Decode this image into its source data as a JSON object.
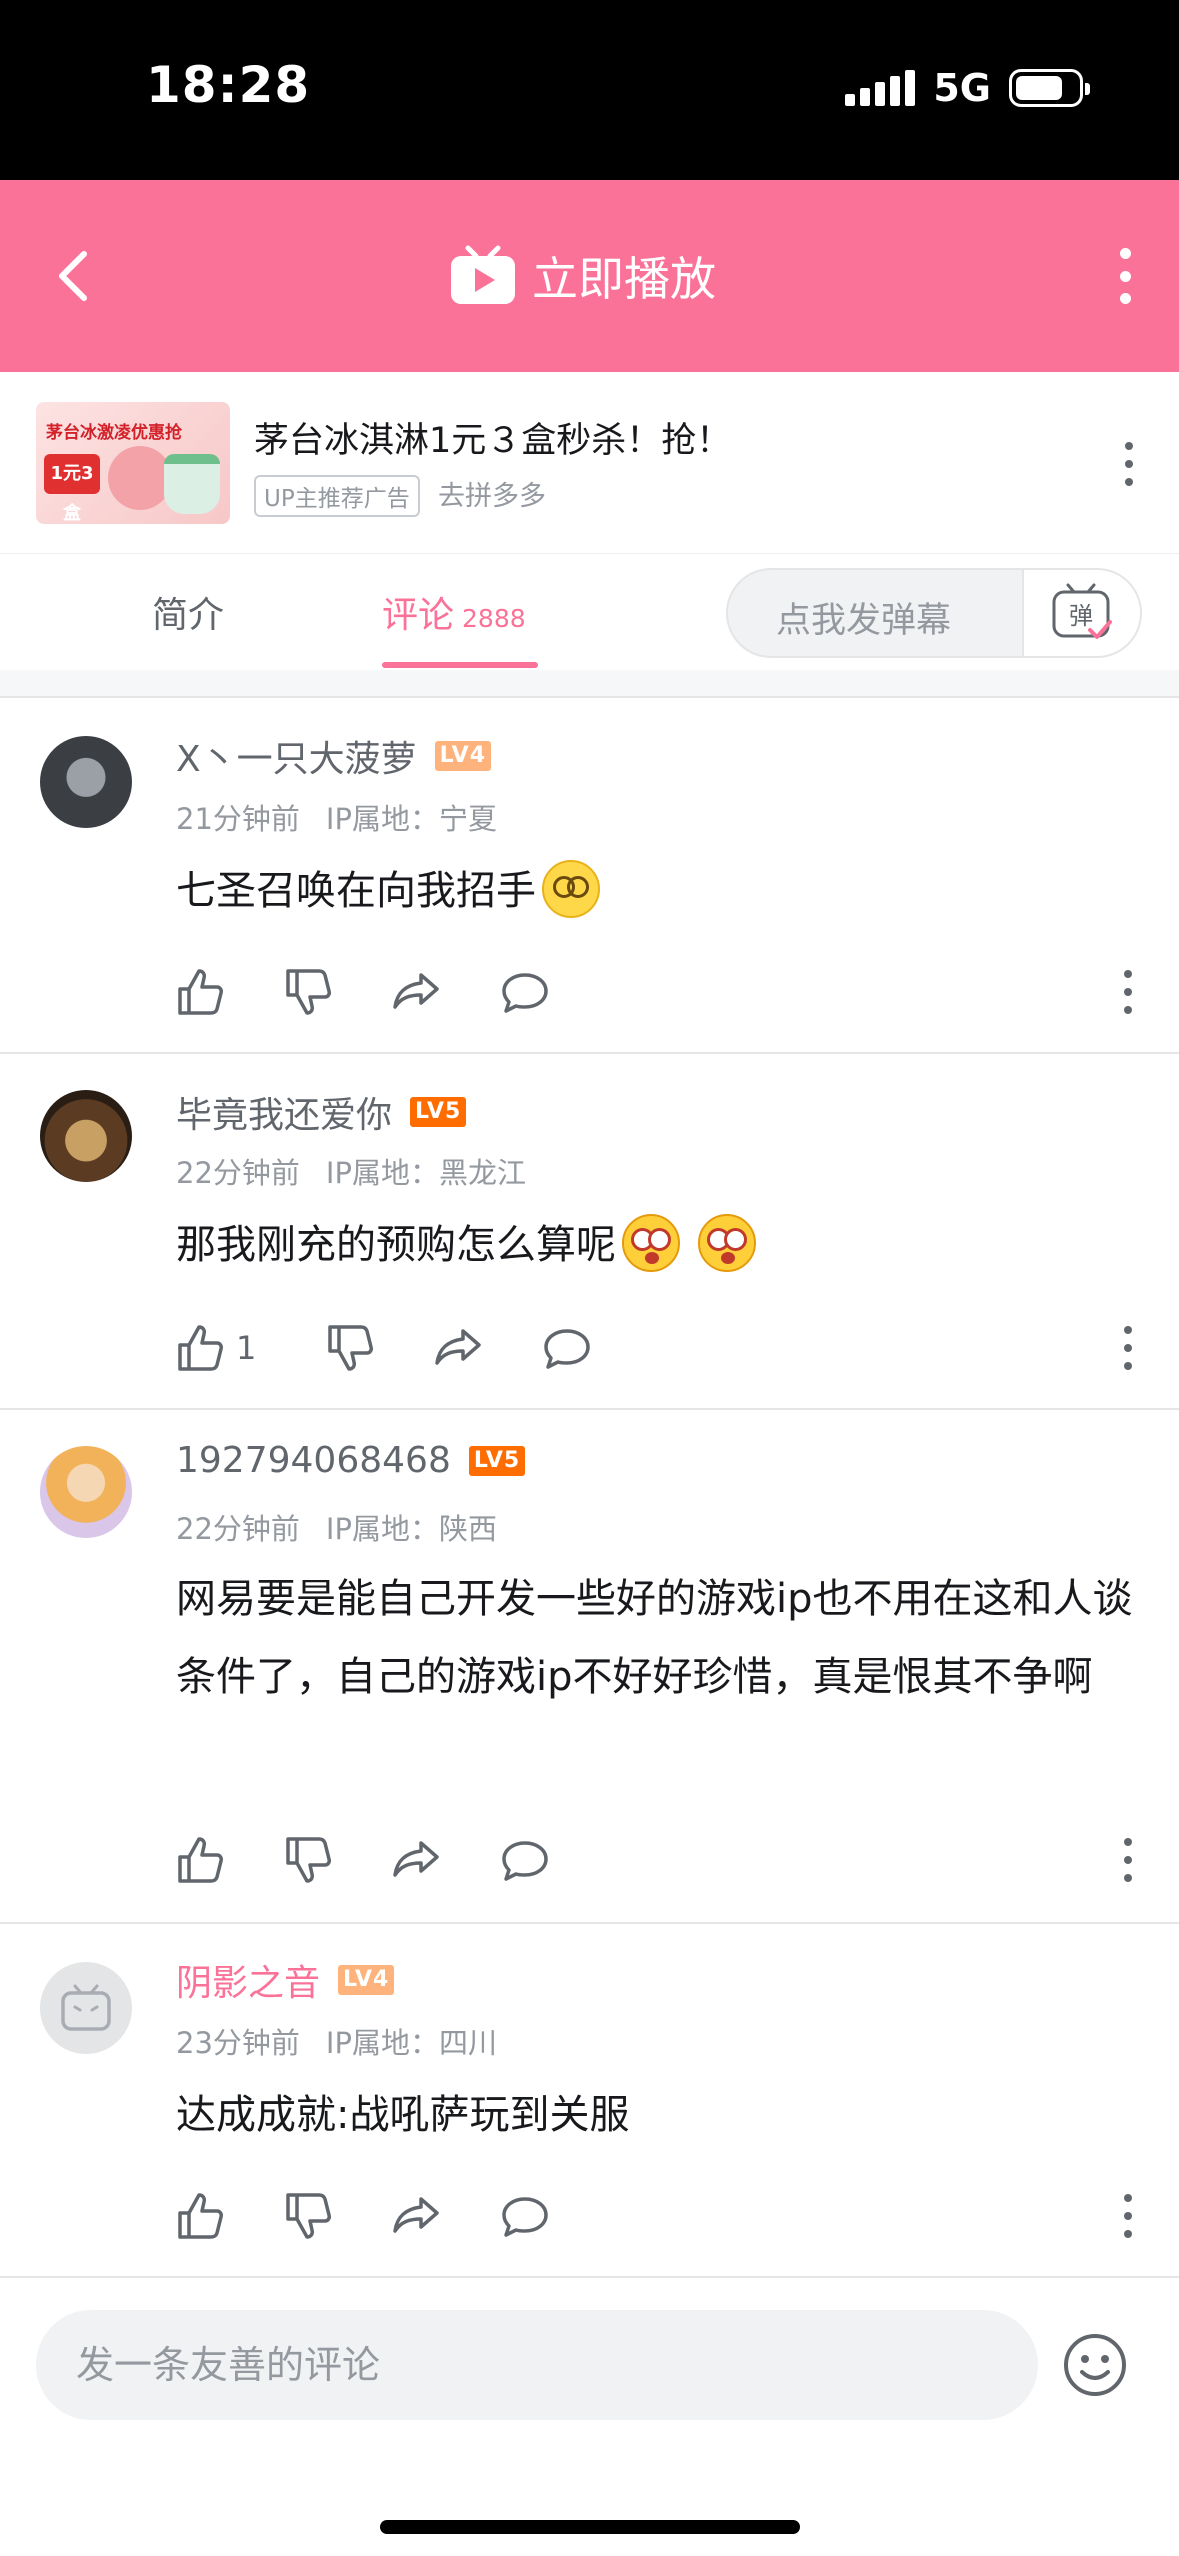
{
  "status_bar": {
    "time": "18:28",
    "network": "5G"
  },
  "header": {
    "title": "立即播放"
  },
  "ad": {
    "thumb_text": "茅台冰激凌优惠抢",
    "thumb_badge": "1元3盒",
    "title": "茅台冰淇淋1元３盒秒杀！抢！",
    "badge": "UP主推荐广告",
    "source": "去拼多多"
  },
  "tabs": {
    "intro": "简介",
    "comments": "评论",
    "comment_count": "2888",
    "danmaku_placeholder": "点我发弹幕",
    "danmaku_button": "弹"
  },
  "comments": [
    {
      "username": "X丶一只大菠萝",
      "level": "LV4",
      "time": "21分钟前",
      "ip": "IP属地：宁夏",
      "text": "七圣召唤在向我招手",
      "emojis": [
        "dizzy"
      ],
      "likes": ""
    },
    {
      "username": "毕竟我还爱你",
      "level": "LV5",
      "time": "22分钟前",
      "ip": "IP属地：黑龙江",
      "text": "那我刚充的预购怎么算呢",
      "emojis": [
        "shock",
        "shock"
      ],
      "likes": "1"
    },
    {
      "username": "192794068468",
      "level": "LV5",
      "time": "22分钟前",
      "ip": "IP属地：陕西",
      "text": "网易要是能自己开发一些好的游戏ip也不用在这和人谈条件了，自己的游戏ip不好好珍惜，真是恨其不争啊",
      "emojis": [],
      "likes": ""
    },
    {
      "username": "阴影之音",
      "level": "LV4",
      "time": "23分钟前",
      "ip": "IP属地：四川",
      "text": "达成成就:战吼萨玩到关服",
      "emojis": [],
      "likes": ""
    }
  ],
  "bottom": {
    "input_placeholder": "发一条友善的评论"
  },
  "colors": {
    "brand": "#fb7299",
    "lv4": "#ffb37c",
    "lv5": "#ff6c00"
  }
}
